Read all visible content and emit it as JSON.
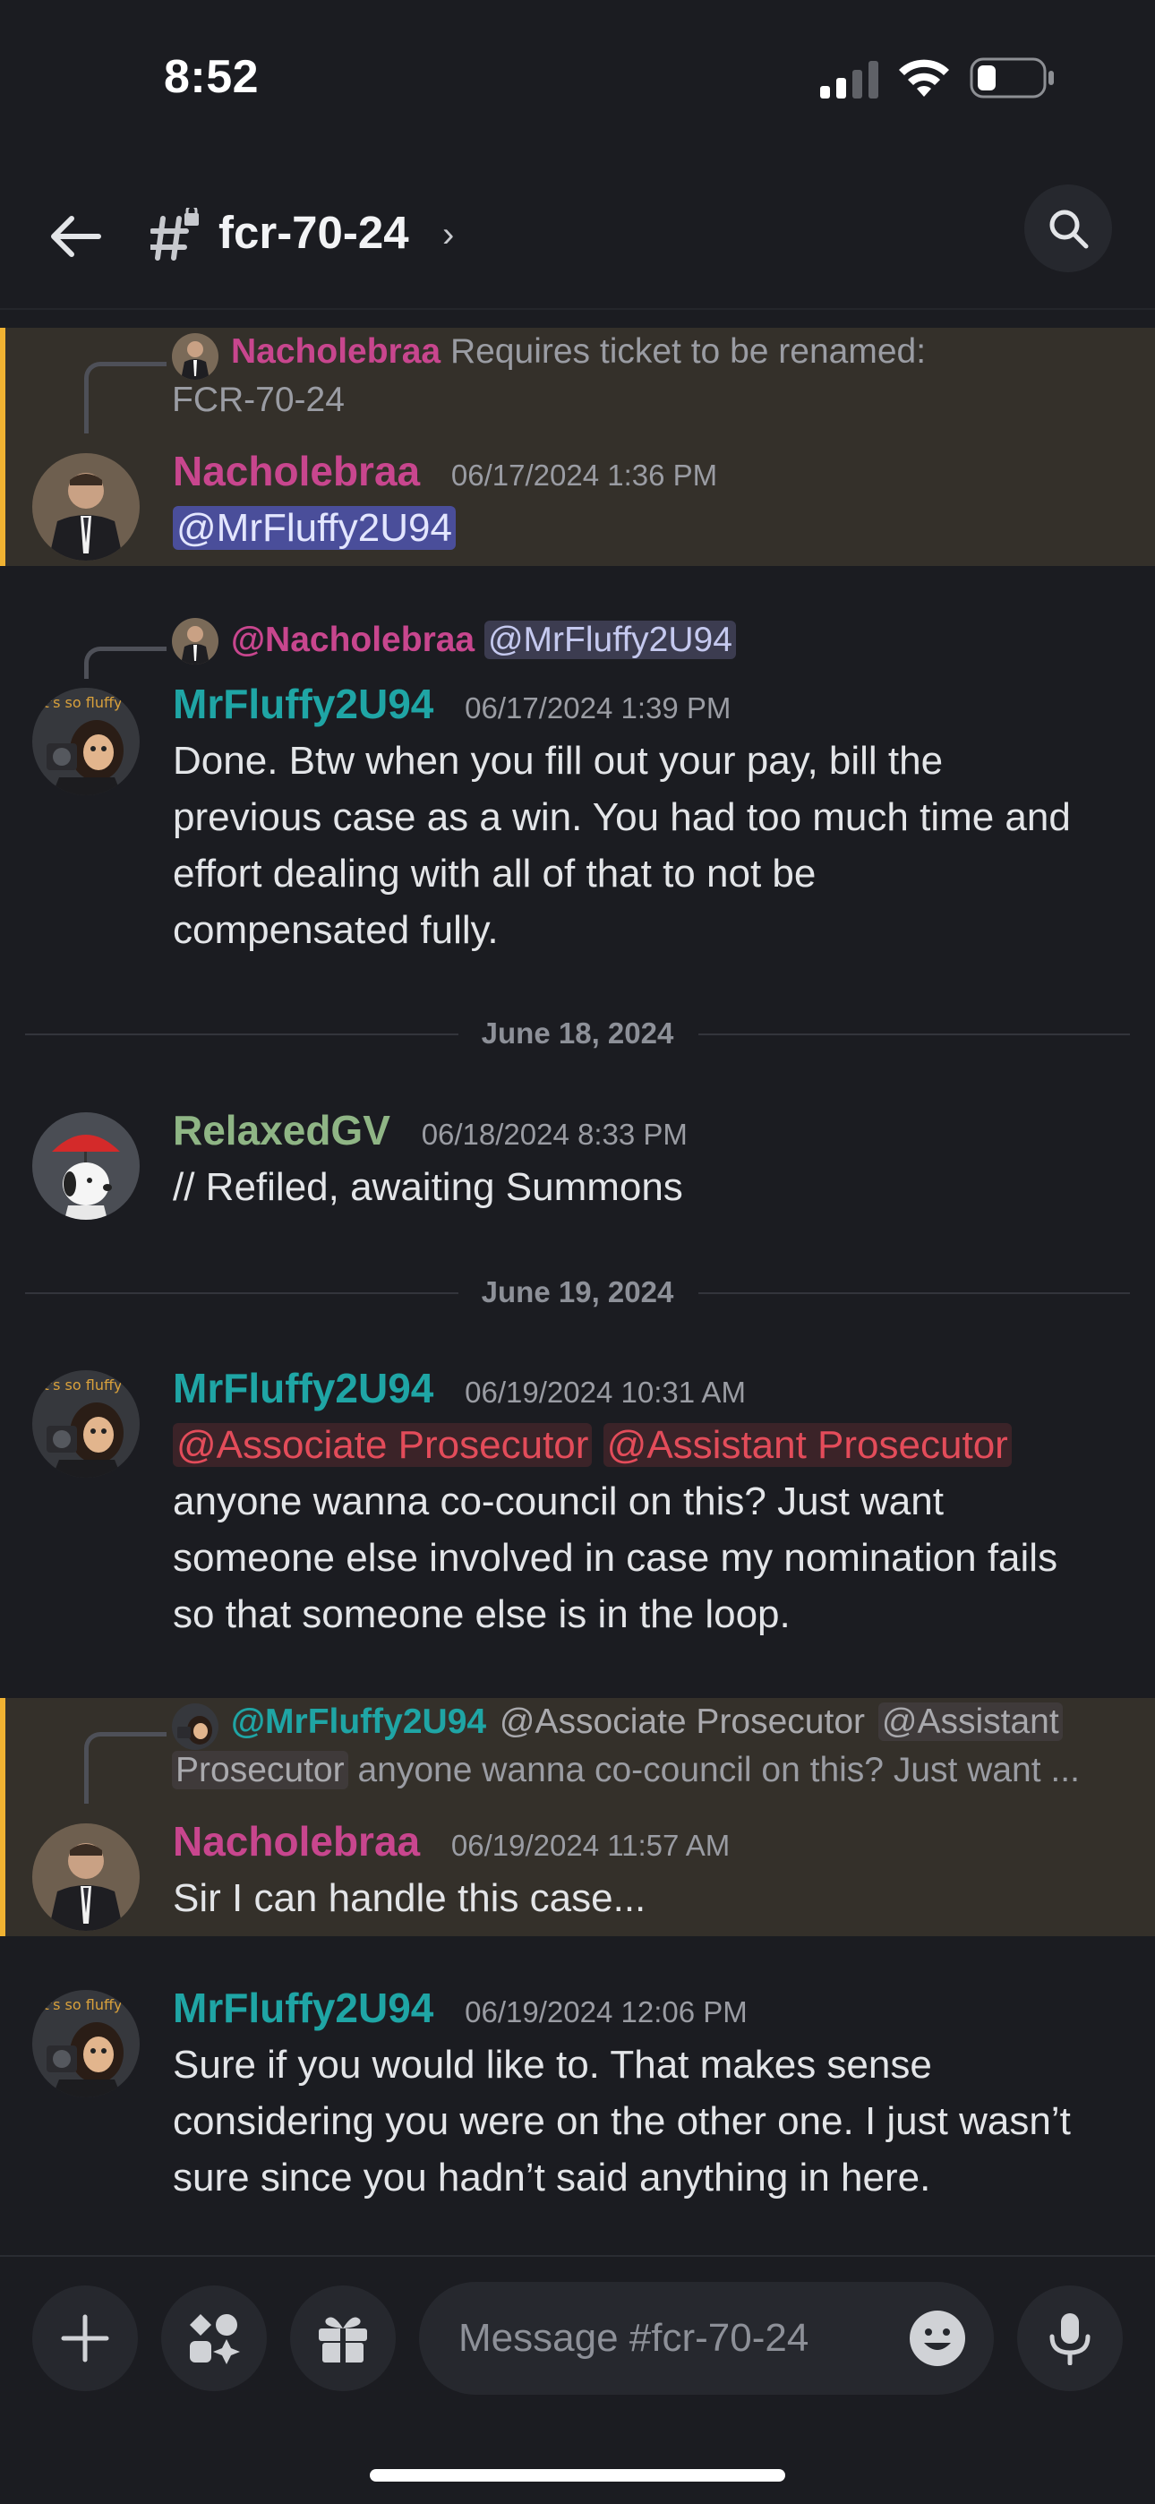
{
  "status_bar": {
    "time": "8:52",
    "icons": [
      "cellular-signal-icon",
      "wifi-icon",
      "battery-icon"
    ]
  },
  "header": {
    "channel_name": "fcr-70-24",
    "icons": [
      "back-arrow-icon",
      "locked-hash-icon",
      "chevron-right-icon",
      "search-icon"
    ]
  },
  "messages": [
    {
      "highlighted": true,
      "reply": {
        "author": "Nacholebraa",
        "author_color": "#c8468e",
        "text_line1": "Requires ticket to be renamed:",
        "text_line2": "FCR-70-24"
      },
      "author": "Nacholebraa",
      "author_color": "#c8468e",
      "timestamp": "06/17/2024 1:36 PM",
      "mention": "@MrFluffy2U94"
    },
    {
      "highlighted": false,
      "reply": {
        "author": "@Nacholebraa",
        "author_color": "#c8468e",
        "mention": "@MrFluffy2U94"
      },
      "author": "MrFluffy2U94",
      "author_color": "#1fa5a5",
      "timestamp": "06/17/2024 1:39 PM",
      "lines": [
        "Done. Btw when you fill out your pay, bill the",
        "previous case as a win. You had too much time and",
        "effort dealing with all of that to not be",
        "compensated fully."
      ]
    },
    {
      "author": "RelaxedGV",
      "author_color": "#8fb585",
      "timestamp": "06/18/2024 8:33 PM",
      "lines": [
        "// Refiled, awaiting Summons"
      ]
    },
    {
      "author": "MrFluffy2U94",
      "author_color": "#1fa5a5",
      "timestamp": "06/19/2024 10:31 AM",
      "role_mentions": [
        "@Associate Prosecutor",
        "@Assistant Prosecutor"
      ],
      "lines": [
        "anyone wanna co-council on this? Just want",
        "someone else involved in case my nomination fails",
        "so that someone else is in the loop."
      ]
    },
    {
      "highlighted": true,
      "reply": {
        "author": "@MrFluffy2U94",
        "author_color": "#1fa5a5",
        "role1": "@Associate Prosecutor",
        "role2_part1": "@Assistant",
        "role2_part2": "Prosecutor",
        "text": "anyone wanna co-council on this? Just want ..."
      },
      "author": "Nacholebraa",
      "author_color": "#c8468e",
      "timestamp": "06/19/2024 11:57 AM",
      "lines": [
        "Sir I can handle this case..."
      ]
    },
    {
      "author": "MrFluffy2U94",
      "author_color": "#1fa5a5",
      "timestamp": "06/19/2024 12:06 PM",
      "lines": [
        "Sure if you would like to. That makes sense",
        "considering you were on the other one. I just wasn’t",
        "sure since you hadn’t said anything in here."
      ]
    }
  ],
  "date_dividers": [
    "June 18, 2024",
    "June 19, 2024"
  ],
  "composer": {
    "placeholder": "Message #fcr-70-24",
    "icons": [
      "plus-icon",
      "apps-icon",
      "gift-icon",
      "emoji-icon",
      "microphone-icon"
    ]
  },
  "colors": {
    "background": "#1b1c21",
    "highlight_bg": "#34302a",
    "highlight_bar": "#f0b232",
    "mention_bg": "#4a4e9a",
    "role_mention_color": "#e34c5a"
  }
}
